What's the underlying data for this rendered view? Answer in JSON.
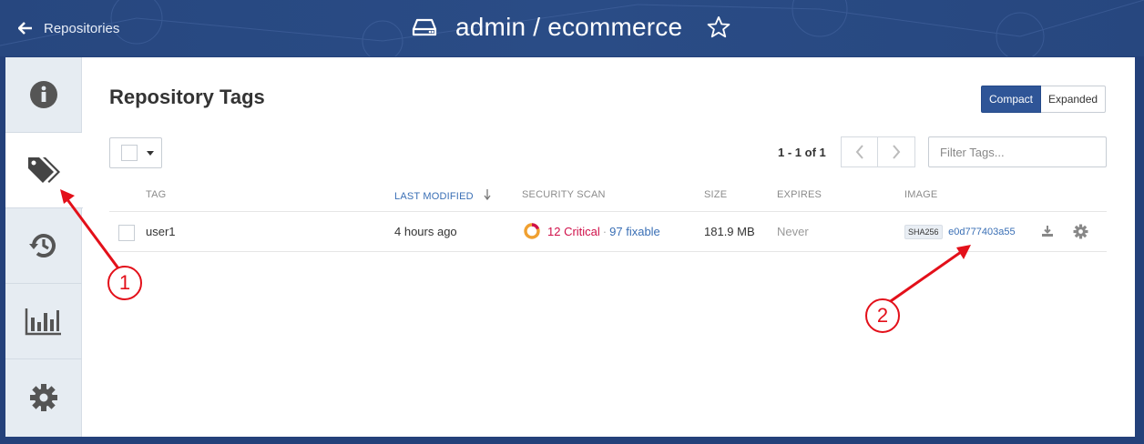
{
  "header": {
    "back_label": "Repositories",
    "repo_title": "admin / ecommerce"
  },
  "sidebar": {
    "items": [
      {
        "name": "info",
        "icon": "info-icon"
      },
      {
        "name": "tags",
        "icon": "tags-icon",
        "active": true
      },
      {
        "name": "history",
        "icon": "history-icon"
      },
      {
        "name": "usage",
        "icon": "bar-chart-icon"
      },
      {
        "name": "settings",
        "icon": "gear-icon"
      }
    ]
  },
  "main": {
    "title": "Repository Tags",
    "view_toggle": {
      "compact": "Compact",
      "expanded": "Expanded",
      "selected": "Compact"
    },
    "pagination": {
      "info": "1 - 1 of 1"
    },
    "filter": {
      "placeholder": "Filter Tags..."
    },
    "columns": {
      "tag": "TAG",
      "last_modified": "LAST MODIFIED",
      "security_scan": "SECURITY SCAN",
      "size": "SIZE",
      "expires": "EXPIRES",
      "image": "IMAGE"
    },
    "rows": [
      {
        "tag": "user1",
        "last_modified": "4 hours ago",
        "critical": "12 Critical",
        "separator": "·",
        "fixable": "97 fixable",
        "size": "181.9 MB",
        "expires": "Never",
        "sha_label": "SHA256",
        "sha": "e0d777403a55"
      }
    ]
  },
  "annotations": {
    "one": "1",
    "two": "2"
  },
  "colors": {
    "header_bg": "#27477f",
    "accent": "#2f5597",
    "critical": "#d0114a",
    "link": "#3a6fb5",
    "annotation": "#e3101a"
  }
}
